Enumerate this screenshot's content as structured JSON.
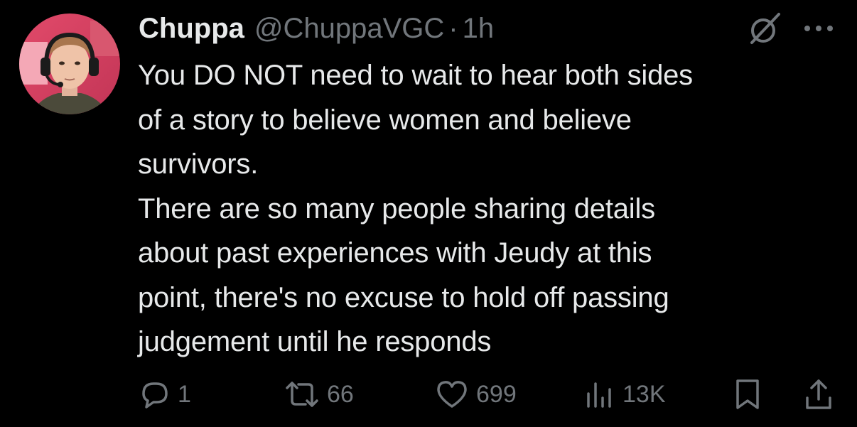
{
  "tweet": {
    "author": {
      "display_name": "Chuppa",
      "handle": "@ChuppaVGC",
      "separator": "·",
      "time": "1h",
      "avatar_icon": "profile-avatar"
    },
    "body_lines": [
      "You DO NOT need to wait to hear both sides",
      "of a story to believe women and believe",
      "survivors.",
      "There are so many people sharing details",
      "about past experiences with Jeudy at this",
      "point, there's no excuse to hold off passing",
      "judgement until he responds"
    ],
    "actions": {
      "reply_count": "1",
      "repost_count": "66",
      "like_count": "699",
      "views_count": "13K"
    },
    "icons": {
      "grok": "grok-icon",
      "more": "more-icon",
      "reply": "reply-icon",
      "repost": "repost-icon",
      "like": "heart-icon",
      "views": "views-icon",
      "bookmark": "bookmark-icon",
      "share": "share-icon"
    },
    "colors": {
      "background": "#000000",
      "primary_text": "#e7e9ea",
      "secondary_text": "#71767b"
    }
  }
}
